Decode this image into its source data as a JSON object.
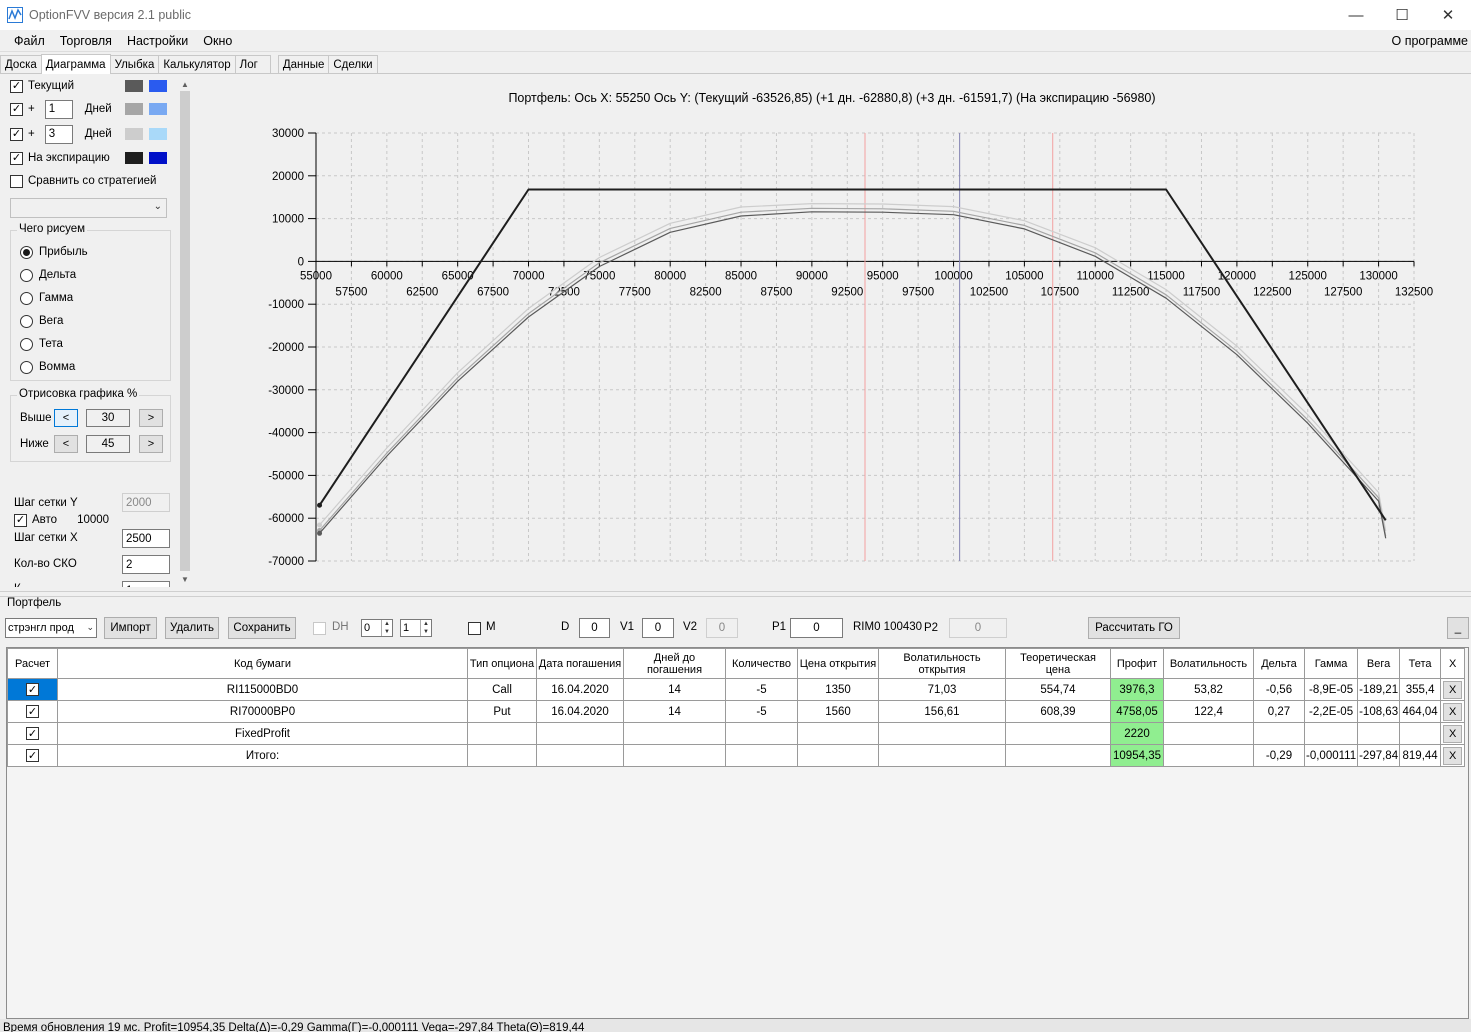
{
  "app": {
    "title": "OptionFVV версия 2.1 public"
  },
  "window_controls": {
    "minimize": "—",
    "maximize": "☐",
    "close": "✕"
  },
  "menu": {
    "items": [
      "Файл",
      "Торговля",
      "Настройки",
      "Окно"
    ],
    "about": "О программе"
  },
  "tabs": [
    "Доска",
    "Диаграмма",
    "Улыбка",
    "Калькулятор",
    "Лог",
    "Данные",
    "Сделки"
  ],
  "active_tab": "Диаграмма",
  "left": {
    "current_label": "Текущий",
    "plus": "+",
    "days1": "1",
    "days3": "3",
    "days_label": "Дней",
    "expiry_label": "На экспирацию",
    "compare_label": "Сравнить со стратегией",
    "draw_group_title": "Чего рисуем",
    "radios": [
      "Прибыль",
      "Дельта",
      "Гамма",
      "Вега",
      "Тета",
      "Вомма"
    ],
    "selected_radio": "Прибыль",
    "render_group_title": "Отрисовка графика %",
    "above_label": "Выше",
    "below_label": "Ниже",
    "above_value": "30",
    "below_value": "45",
    "btn_less": "<",
    "btn_more": ">",
    "grid_y_label": "Шаг сетки Y",
    "grid_y_value": "2000",
    "auto_label": "Авто",
    "auto_value": "10000",
    "grid_x_label": "Шаг сетки X",
    "grid_x_value": "2500",
    "sko_label": "Кол-во СКО",
    "sko_value": "2",
    "cut_label": "К",
    "cut_value": "1",
    "colors": {
      "current": [
        "#5a5a5a",
        "#2a5bef"
      ],
      "plus1": [
        "#a6a6a6",
        "#79a9f2"
      ],
      "plus3": [
        "#cdcdcd",
        "#a9d9f9"
      ],
      "expiry": [
        "#1e1e1e",
        "#0010c8"
      ]
    }
  },
  "chart_header": {
    "title": "Портфель: Ось X: 55250 Ось Y:  (Текущий -63526,85)  (+1 дн. -62880,8)  (+3 дн. -61591,7)  (На экспирацию -56980)"
  },
  "chart_data": {
    "type": "line",
    "title": "",
    "xlabel": "",
    "ylabel": "",
    "xlim": [
      55000,
      132500
    ],
    "ylim": [
      -70000,
      30000
    ],
    "x_ticks_upper": [
      55000,
      60000,
      65000,
      70000,
      75000,
      80000,
      85000,
      90000,
      95000,
      100000,
      105000,
      110000,
      115000,
      120000,
      125000,
      130000
    ],
    "x_ticks_lower": [
      57500,
      62500,
      67500,
      72500,
      77500,
      82500,
      87500,
      92500,
      97500,
      102500,
      107500,
      112500,
      117500,
      122500,
      127500,
      132500
    ],
    "y_ticks": [
      30000,
      20000,
      10000,
      0,
      -10000,
      -20000,
      -30000,
      -40000,
      -50000,
      -60000,
      -70000
    ],
    "vertical_lines": [
      {
        "x": 93750,
        "color": "#f3a0a0"
      },
      {
        "x": 100430,
        "color": "#8080b0"
      },
      {
        "x": 107000,
        "color": "#f3a0a0"
      }
    ],
    "series": [
      {
        "name": "На экспирацию",
        "color": "#1e1e1e",
        "points": [
          [
            55250,
            -56980
          ],
          [
            70000,
            16800
          ],
          [
            115000,
            16800
          ],
          [
            130500,
            -60500
          ]
        ]
      },
      {
        "name": "Текущий",
        "color": "#5a5a5a",
        "points": [
          [
            55250,
            -63527
          ],
          [
            60000,
            -45500
          ],
          [
            65000,
            -28000
          ],
          [
            70000,
            -13000
          ],
          [
            75000,
            -1200
          ],
          [
            80000,
            6800
          ],
          [
            85000,
            10600
          ],
          [
            90000,
            11600
          ],
          [
            95000,
            11500
          ],
          [
            100000,
            10900
          ],
          [
            105000,
            7600
          ],
          [
            110000,
            1200
          ],
          [
            115000,
            -8600
          ],
          [
            120000,
            -21800
          ],
          [
            125000,
            -37800
          ],
          [
            130000,
            -56000
          ],
          [
            130500,
            -64700
          ]
        ]
      },
      {
        "name": "+1 дн.",
        "color": "#a6a6a6",
        "points": [
          [
            55250,
            -62881
          ],
          [
            60000,
            -44800
          ],
          [
            65000,
            -27200
          ],
          [
            70000,
            -12200
          ],
          [
            75000,
            -300
          ],
          [
            80000,
            7700
          ],
          [
            85000,
            11500
          ],
          [
            90000,
            12400
          ],
          [
            95000,
            12300
          ],
          [
            100000,
            11700
          ],
          [
            105000,
            8400
          ],
          [
            110000,
            2000
          ],
          [
            115000,
            -7800
          ],
          [
            120000,
            -21000
          ],
          [
            125000,
            -37000
          ],
          [
            130000,
            -55200
          ],
          [
            130500,
            -64200
          ]
        ]
      },
      {
        "name": "+3 дн.",
        "color": "#cdcdcd",
        "points": [
          [
            55250,
            -61592
          ],
          [
            60000,
            -43600
          ],
          [
            65000,
            -26000
          ],
          [
            70000,
            -11000
          ],
          [
            75000,
            900
          ],
          [
            80000,
            8900
          ],
          [
            85000,
            12700
          ],
          [
            90000,
            13500
          ],
          [
            95000,
            13400
          ],
          [
            100000,
            12800
          ],
          [
            105000,
            9500
          ],
          [
            110000,
            3200
          ],
          [
            115000,
            -6600
          ],
          [
            120000,
            -19800
          ],
          [
            125000,
            -35800
          ],
          [
            130000,
            -54000
          ],
          [
            130500,
            -63000
          ]
        ]
      }
    ],
    "grid": true
  },
  "portfolio": {
    "label": "Портфель",
    "strategy_combo": "стрэнгл прод",
    "import_btn": "Импорт",
    "delete_btn": "Удалить",
    "save_btn": "Сохранить",
    "dh_label": "DH",
    "spin1": "0",
    "spin2": "1",
    "m_label": "M",
    "d_label": "D",
    "d_value": "0",
    "v1_label": "V1",
    "v1_value": "0",
    "v2_label": "V2",
    "v2_value": "0",
    "p1_label": "P1",
    "p1_value": "0",
    "rim_label": "RIM0 100430",
    "p2_label": "P2",
    "p2_value": "0",
    "calc_btn": "Рассчитать ГО",
    "min_btn": "_"
  },
  "grid": {
    "headers": [
      "Расчет",
      "Код бумаги",
      "Тип опциона",
      "Дата погашения",
      "Дней до погашения",
      "Количество",
      "Цена открытия",
      "Волатильность открытия",
      "Теоретическая цена",
      "Профит",
      "Волатильность",
      "Дельта",
      "Гамма",
      "Вега",
      "Тета",
      "X"
    ],
    "rows": [
      {
        "checked": true,
        "selected": true,
        "code": "RI115000BD0",
        "type": "Call",
        "date": "16.04.2020",
        "days": "14",
        "qty": "-5",
        "price": "1350",
        "vol_open": "71,03",
        "theo": "554,74",
        "profit": "3976,3",
        "vol": "53,82",
        "delta": "-0,56",
        "gamma": "-8,9E-05",
        "vega": "-189,21",
        "theta": "355,4",
        "x": "X"
      },
      {
        "checked": true,
        "selected": false,
        "code": "RI70000BP0",
        "type": "Put",
        "date": "16.04.2020",
        "days": "14",
        "qty": "-5",
        "price": "1560",
        "vol_open": "156,61",
        "theo": "608,39",
        "profit": "4758,05",
        "vol": "122,4",
        "delta": "0,27",
        "gamma": "-2,2E-05",
        "vega": "-108,63",
        "theta": "464,04",
        "x": "X"
      },
      {
        "checked": true,
        "selected": false,
        "code": "FixedProfit",
        "type": "",
        "date": "",
        "days": "",
        "qty": "",
        "price": "",
        "vol_open": "",
        "theo": "",
        "profit": "2220",
        "vol": "",
        "delta": "",
        "gamma": "",
        "vega": "",
        "theta": "",
        "x": "X"
      },
      {
        "checked": true,
        "selected": false,
        "code": "Итого:",
        "type": "",
        "date": "",
        "days": "",
        "qty": "",
        "price": "",
        "vol_open": "",
        "theo": "",
        "profit": "10954,35",
        "vol": "",
        "delta": "-0,29",
        "gamma": "-0,000111",
        "vega": "-297,84",
        "theta": "819,44",
        "x": "X"
      }
    ]
  },
  "status": {
    "text": "Время обновления 19 мс. Profit=10954,35 Delta(Δ)=-0,29 Gamma(Γ)=-0,000111 Vega=-297,84 Theta(Θ)=819,44"
  }
}
